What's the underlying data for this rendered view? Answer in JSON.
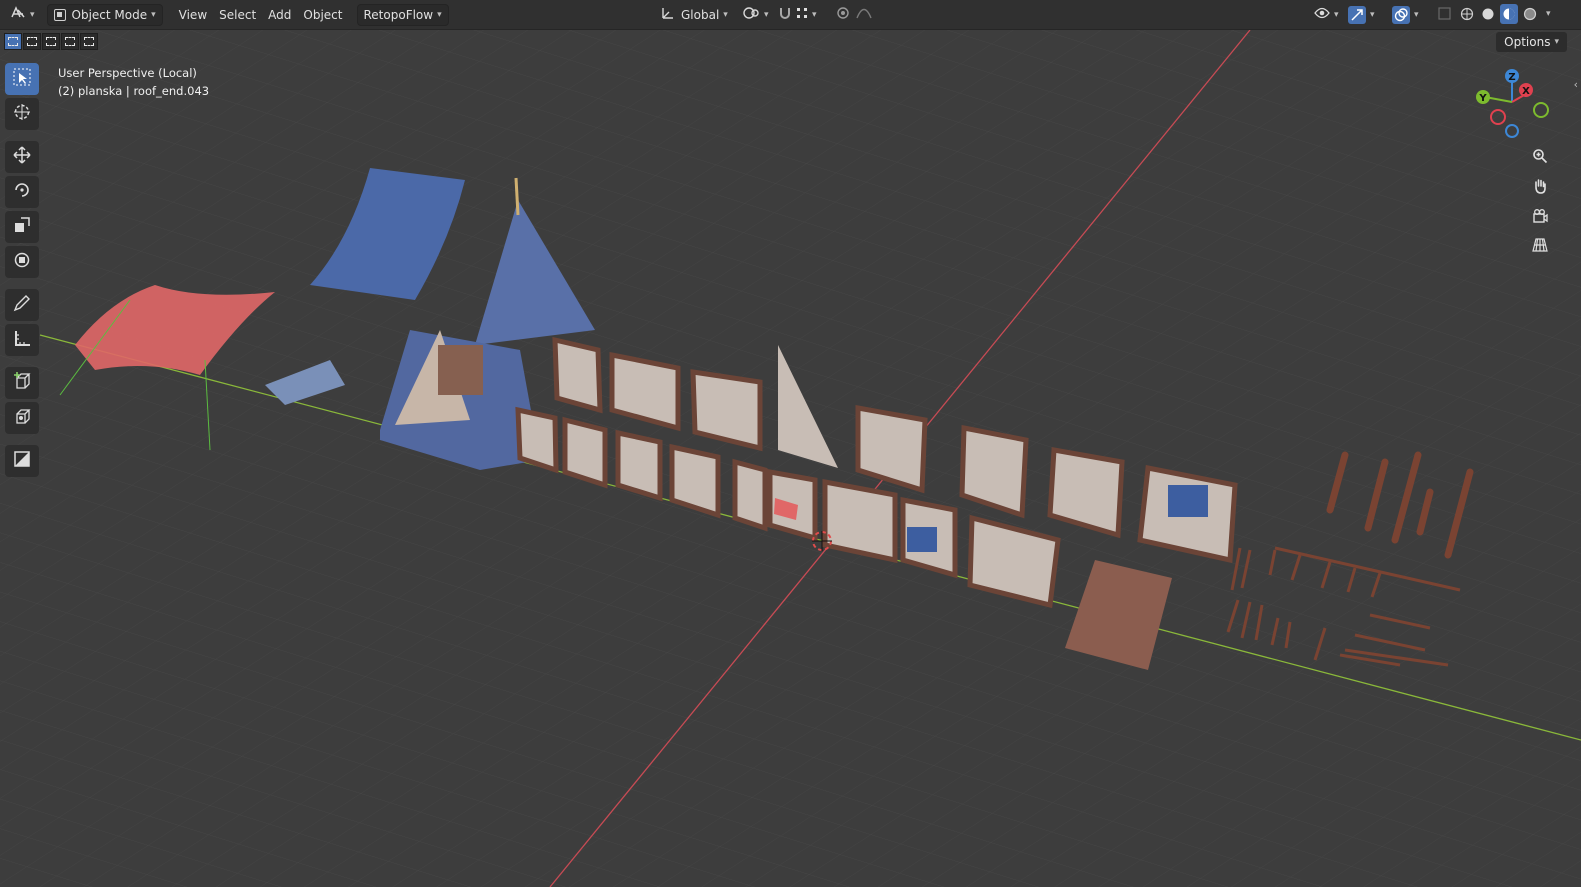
{
  "header": {
    "editor_type_icon": "3d-viewport-icon",
    "mode": "Object Mode",
    "menus": [
      "View",
      "Select",
      "Add",
      "Object"
    ],
    "addon_menu": "RetopoFlow",
    "transform_orientation": "Global",
    "pivot_icon": "pivot-point-icon",
    "snap_icon": "snap-magnet-icon",
    "proportional_icon": "proportional-edit-icon"
  },
  "toolbar_right": {
    "options_label": "Options"
  },
  "viewport": {
    "perspective_label": "User Perspective (Local)",
    "object_label": "(2) planska | roof_end.043"
  },
  "gizmo": {
    "x_label": "X",
    "y_label": "Y",
    "z_label": "Z",
    "x_color": "#e0414f",
    "y_color": "#7dbb2e",
    "z_color": "#3d87d6"
  },
  "tools": [
    {
      "name": "select-box-tool",
      "icon": "cursor-select-icon",
      "active": true
    },
    {
      "name": "cursor-tool",
      "icon": "3d-cursor-icon"
    },
    {
      "name": "move-tool",
      "icon": "move-arrows-icon"
    },
    {
      "name": "rotate-tool",
      "icon": "rotate-icon"
    },
    {
      "name": "scale-tool",
      "icon": "scale-icon"
    },
    {
      "name": "transform-tool",
      "icon": "transform-icon"
    },
    {
      "name": "annotate-tool",
      "icon": "pencil-icon"
    },
    {
      "name": "measure-tool",
      "icon": "ruler-icon"
    },
    {
      "name": "add-cube-tool",
      "icon": "add-cube-icon"
    },
    {
      "name": "retopoflow-tool",
      "icon": "retopoflow-icon"
    },
    {
      "name": "extra-tool",
      "icon": "panel-icon"
    }
  ],
  "colors": {
    "header_bg": "#303030",
    "viewport_bg": "#3d3d3d",
    "accent": "#4772b3",
    "x_axis": "#c64b54",
    "y_axis": "#8ab83a"
  }
}
